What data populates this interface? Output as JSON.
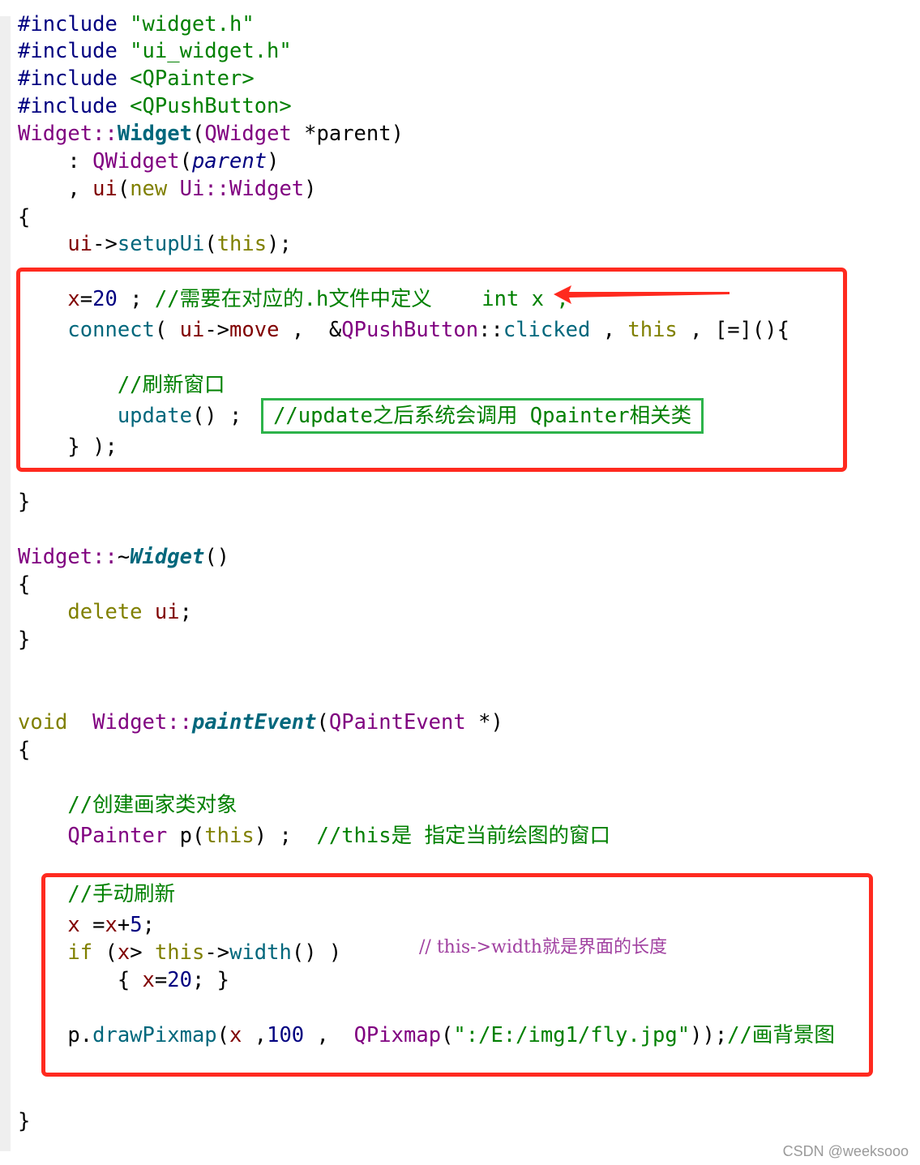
{
  "editor": {
    "lines": [
      [
        [
          "#include ",
          "pp"
        ],
        [
          "\"widget.h\"",
          "str"
        ]
      ],
      [
        [
          "#include ",
          "pp"
        ],
        [
          "\"ui_widget.h\"",
          "str"
        ]
      ],
      [
        [
          "#include ",
          "pp"
        ],
        [
          "<QPainter>",
          "str"
        ]
      ],
      [
        [
          "#include ",
          "pp"
        ],
        [
          "<QPushButton>",
          "str"
        ]
      ],
      [
        [
          "Widget::",
          "cls"
        ],
        [
          "Widget",
          "fnb"
        ],
        [
          "(",
          "p"
        ],
        [
          "QWidget",
          "cls"
        ],
        [
          " *parent)",
          "p"
        ]
      ],
      [
        [
          "    : ",
          "p"
        ],
        [
          "QWidget",
          "cls"
        ],
        [
          "(",
          "p"
        ],
        [
          "parent",
          "it"
        ],
        [
          ")",
          "p"
        ]
      ],
      [
        [
          "    , ",
          "p"
        ],
        [
          "ui",
          "mem"
        ],
        [
          "(",
          "p"
        ],
        [
          "new",
          "kw"
        ],
        [
          " ",
          "p"
        ],
        [
          "Ui::Widget",
          "cls"
        ],
        [
          ")",
          "p"
        ]
      ],
      [
        [
          "{",
          "p"
        ]
      ],
      [
        [
          "    ",
          "p"
        ],
        [
          "ui",
          "mem"
        ],
        [
          "->",
          "p"
        ],
        [
          "setupUi",
          "fn"
        ],
        [
          "(",
          "p"
        ],
        [
          "this",
          "kw"
        ],
        [
          ");",
          "p"
        ]
      ],
      [
        [
          "    ",
          "p"
        ],
        [
          "x",
          "mem"
        ],
        [
          "=",
          "p"
        ],
        [
          "20",
          "num"
        ],
        [
          " ; ",
          "p"
        ],
        [
          "//需要在对应的.h文件中定义    int x ;",
          "cm"
        ]
      ],
      [
        [
          "    ",
          "p"
        ],
        [
          "connect",
          "fn"
        ],
        [
          "( ",
          "p"
        ],
        [
          "ui",
          "mem"
        ],
        [
          "->",
          "p"
        ],
        [
          "move",
          "mem"
        ],
        [
          " ,  &",
          "p"
        ],
        [
          "QPushButton",
          "cls"
        ],
        [
          "::",
          "p"
        ],
        [
          "clicked",
          "fn"
        ],
        [
          " , ",
          "p"
        ],
        [
          "this",
          "kw"
        ],
        [
          " , [=](){",
          "p"
        ]
      ],
      [
        [
          "        //刷新窗口",
          "cm"
        ]
      ],
      [
        [
          "        ",
          "p"
        ],
        [
          "update",
          "fn"
        ],
        [
          "() ;  ",
          "p"
        ],
        [
          "//update之后系统会调用 Qpainter相关类",
          "cm boxed"
        ]
      ],
      [
        [
          "    } );",
          "p"
        ]
      ],
      [
        [
          "}",
          "p"
        ]
      ],
      [
        [
          "Widget::",
          "cls"
        ],
        [
          "~",
          "p"
        ],
        [
          "Widget",
          "fni"
        ],
        [
          "()",
          "p"
        ]
      ],
      [
        [
          "{",
          "p"
        ]
      ],
      [
        [
          "    ",
          "p"
        ],
        [
          "delete",
          "kw"
        ],
        [
          " ",
          "p"
        ],
        [
          "ui",
          "mem"
        ],
        [
          ";",
          "p"
        ]
      ],
      [
        [
          "}",
          "p"
        ]
      ],
      [
        [
          "void",
          "kw"
        ],
        [
          "  ",
          "p"
        ],
        [
          "Widget::",
          "cls"
        ],
        [
          "paintEvent",
          "fni"
        ],
        [
          "(",
          "p"
        ],
        [
          "QPaintEvent",
          "cls"
        ],
        [
          " *)",
          "p"
        ]
      ],
      [
        [
          "{",
          "p"
        ]
      ],
      [
        [
          "    //创建画家类对象",
          "cm"
        ]
      ],
      [
        [
          "    ",
          "p"
        ],
        [
          "QPainter",
          "cls"
        ],
        [
          " p(",
          "p"
        ],
        [
          "this",
          "kw"
        ],
        [
          ") ;  ",
          "p"
        ],
        [
          "//this是 指定当前绘图的窗口",
          "cm"
        ]
      ],
      [
        [
          "    //手动刷新",
          "cm"
        ]
      ],
      [
        [
          "    ",
          "p"
        ],
        [
          "x",
          "mem"
        ],
        [
          " =",
          "p"
        ],
        [
          "x",
          "mem"
        ],
        [
          "+",
          "p"
        ],
        [
          "5",
          "num"
        ],
        [
          ";",
          "p"
        ]
      ],
      [
        [
          "    ",
          "p"
        ],
        [
          "if",
          "kw"
        ],
        [
          " (",
          "p"
        ],
        [
          "x",
          "mem"
        ],
        [
          "> ",
          "p"
        ],
        [
          "this",
          "kw"
        ],
        [
          "->",
          "p"
        ],
        [
          "width",
          "fn"
        ],
        [
          "() )",
          "p"
        ]
      ],
      [
        [
          "        { ",
          "p"
        ],
        [
          "x",
          "mem"
        ],
        [
          "=",
          "p"
        ],
        [
          "20",
          "num"
        ],
        [
          "; }",
          "p"
        ]
      ],
      [
        [
          "    p.",
          "p"
        ],
        [
          "drawPixmap",
          "fn"
        ],
        [
          "(",
          "p"
        ],
        [
          "x",
          "mem"
        ],
        [
          " ,",
          "p"
        ],
        [
          "100",
          "num"
        ],
        [
          " ,  ",
          "p"
        ],
        [
          "QPixmap",
          "cls"
        ],
        [
          "(",
          "p"
        ],
        [
          "\":/E:/img1/fly.jpg\"",
          "str"
        ],
        [
          "));",
          "p"
        ],
        [
          "//画背景图",
          "cm"
        ]
      ],
      [
        [
          "}",
          "p"
        ]
      ]
    ],
    "annotation_note": "// this->width就是界面的长度",
    "watermark": "CSDN @weeksooo"
  },
  "colors": {
    "highlight_box": "#ff2a1f",
    "comment_box": "#2db34a",
    "arrow": "#ff2a1f"
  }
}
